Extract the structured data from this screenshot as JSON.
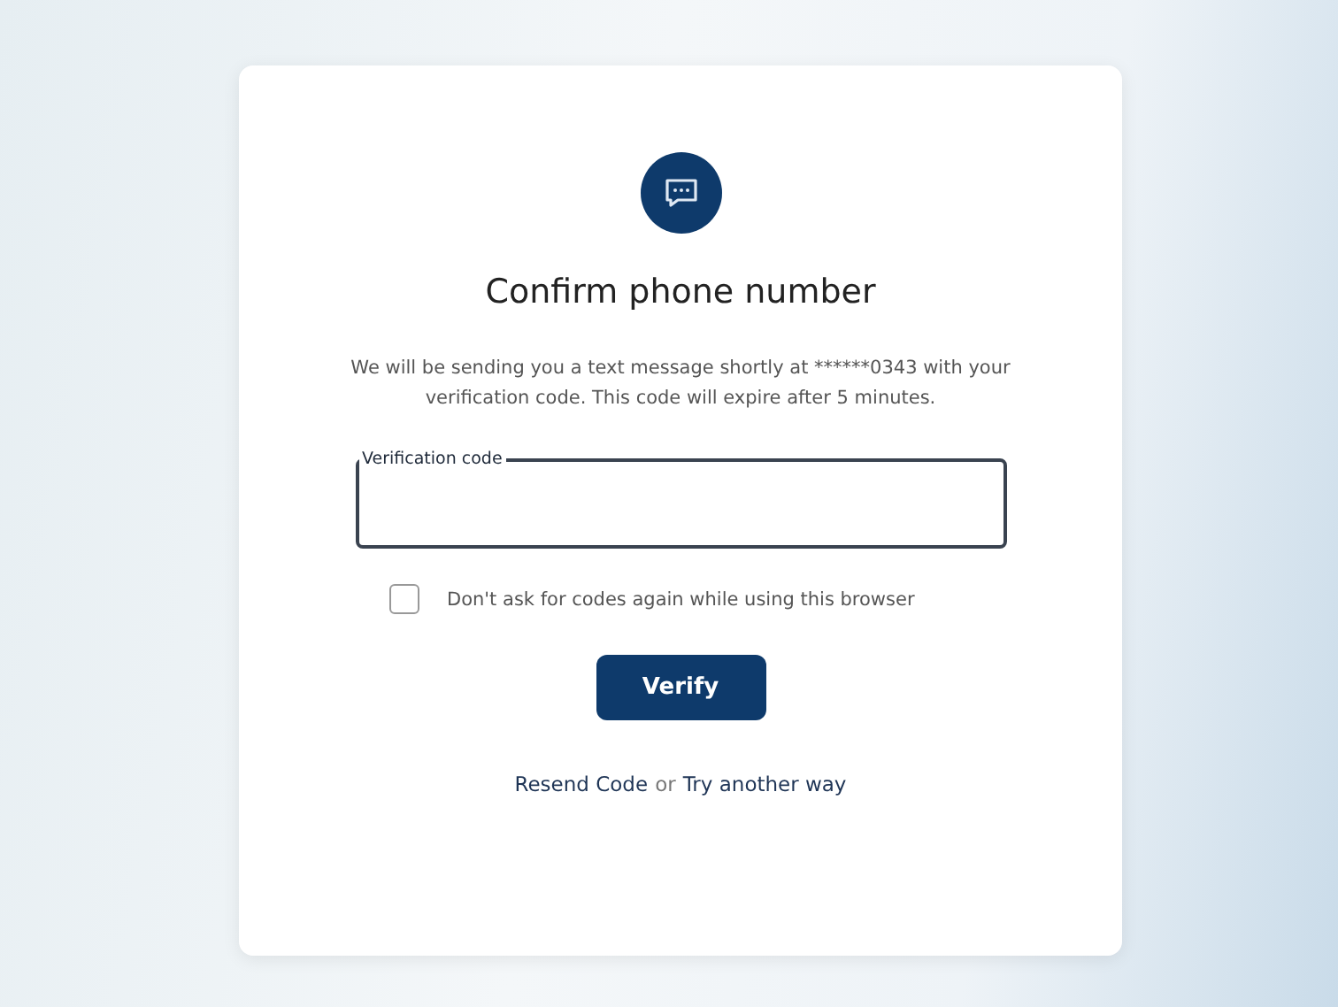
{
  "title": "Confirm phone number",
  "message": "We will be sending you a text message shortly at ******0343 with your verification code. This code will expire after 5 minutes.",
  "field": {
    "label": "Verification code"
  },
  "remember": {
    "label": "Don't ask for codes again while using this browser",
    "checked": false
  },
  "button": "Verify",
  "footer": {
    "resend": "Resend Code",
    "separator": "or",
    "alternative": "Try another way"
  }
}
